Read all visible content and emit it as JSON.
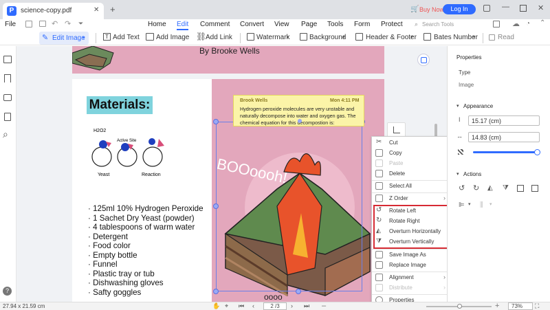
{
  "titlebar": {
    "tab_name": "science-copy.pdf",
    "buy_now": "Buy Now",
    "login": "Log In"
  },
  "menu": {
    "file": "File",
    "items": [
      "Home",
      "Edit",
      "Comment",
      "Convert",
      "View",
      "Page",
      "Tools",
      "Form",
      "Protect"
    ],
    "search_placeholder": "Search Tools"
  },
  "toolbar": {
    "edit_image": "Edit Image",
    "add_text": "Add Text",
    "add_image": "Add Image",
    "add_link": "Add Link",
    "watermark": "Watermark",
    "background": "Background",
    "header_footer": "Header & Footer",
    "bates_number": "Bates Number",
    "read": "Read"
  },
  "document": {
    "author": "By Brooke Wells",
    "materials_title": "Materials:",
    "diagram_labels": {
      "h2o2": "H2O2",
      "active_site": "Active Site",
      "yeast": "Yeast",
      "reaction": "Reaction"
    },
    "materials_list": [
      "125ml 10% Hydrogen Peroxide",
      "1 Sachet Dry Yeast (powder)",
      "4 tablespoons of warm water",
      "Detergent",
      "Food color",
      "Empty bottle",
      "Funnel",
      "Plastic tray or tub",
      "Dishwashing gloves",
      "Safty goggles"
    ],
    "booom": "BOOoooh!",
    "boom2": "oooo"
  },
  "note": {
    "author": "Brook Wells",
    "time": "Mon 4:11 PM",
    "text": "Hydrogen peroxide molecules are very unstable and naturally decompose into water and oxygen gas. The chemical equation for this decompostion is:"
  },
  "context_menu": {
    "cut": "Cut",
    "copy": "Copy",
    "paste": "Paste",
    "delete": "Delete",
    "select_all": "Select All",
    "z_order": "Z Order",
    "rotate_left": "Rotate Left",
    "rotate_right": "Rotate Right",
    "overturn_h": "Overturn Horizontally",
    "overturn_v": "Overturn Vertically",
    "save_image_as": "Save Image As",
    "replace_image": "Replace Image",
    "alignment": "Alignment",
    "distribute": "Distribute",
    "properties": "Properties"
  },
  "properties": {
    "title": "Properties",
    "type_label": "Type",
    "type_value": "Image",
    "appearance": "Appearance",
    "height": "15.17 (cm)",
    "width": "14.83 (cm)",
    "actions": "Actions",
    "opacity": 1.0
  },
  "status": {
    "page_size": "27.94 x 21.59 cm",
    "page": "2 /3",
    "zoom": "73%"
  },
  "colors": {
    "accent": "#2f6bff",
    "page_pink": "#e3a7bc",
    "highlight_red": "#d62a33",
    "materials_bg": "#7fd3dd",
    "note_bg": "#fbf4a8"
  }
}
